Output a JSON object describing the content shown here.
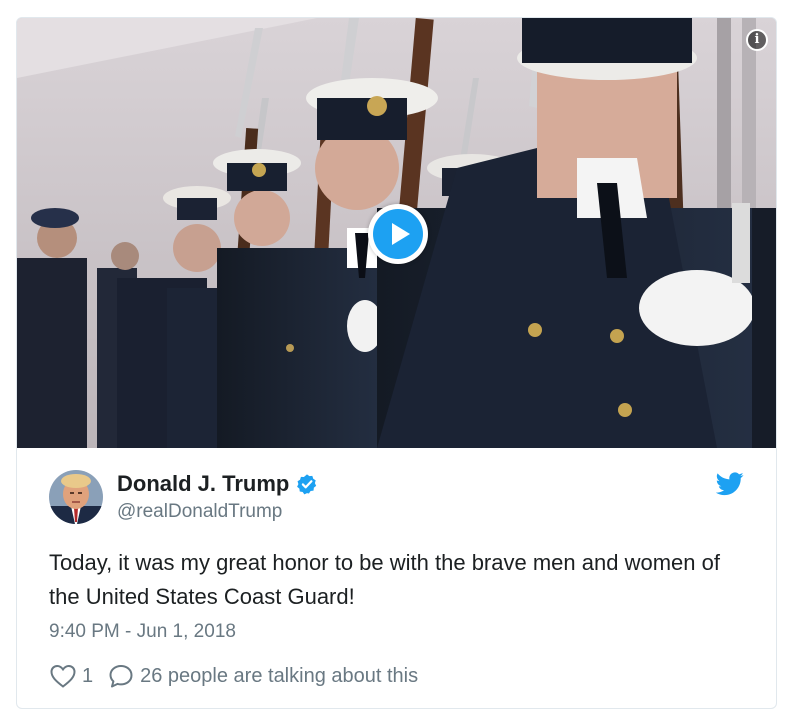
{
  "media": {
    "type": "video",
    "play_icon": "play-icon",
    "info_icon": "info-icon",
    "info_glyph": "i"
  },
  "author": {
    "name": "Donald J. Trump",
    "handle": "@realDonaldTrump",
    "verified": true,
    "avatar_icon": "avatar"
  },
  "tweet": {
    "text": "Today, it was my great honor to be with the brave men and women of the United States Coast Guard!",
    "timestamp": "9:40 PM - Jun 1, 2018"
  },
  "actions": {
    "likes": "1",
    "conversation": "26 people are talking about this"
  },
  "colors": {
    "twitter_blue": "#1da1f2",
    "text_primary": "#1c2022",
    "text_secondary": "#697882",
    "border": "#e1e8ed"
  },
  "icons": {
    "brand": "twitter-bird-icon",
    "verified": "verified-badge-icon",
    "like": "heart-icon",
    "reply": "speech-bubble-icon"
  }
}
